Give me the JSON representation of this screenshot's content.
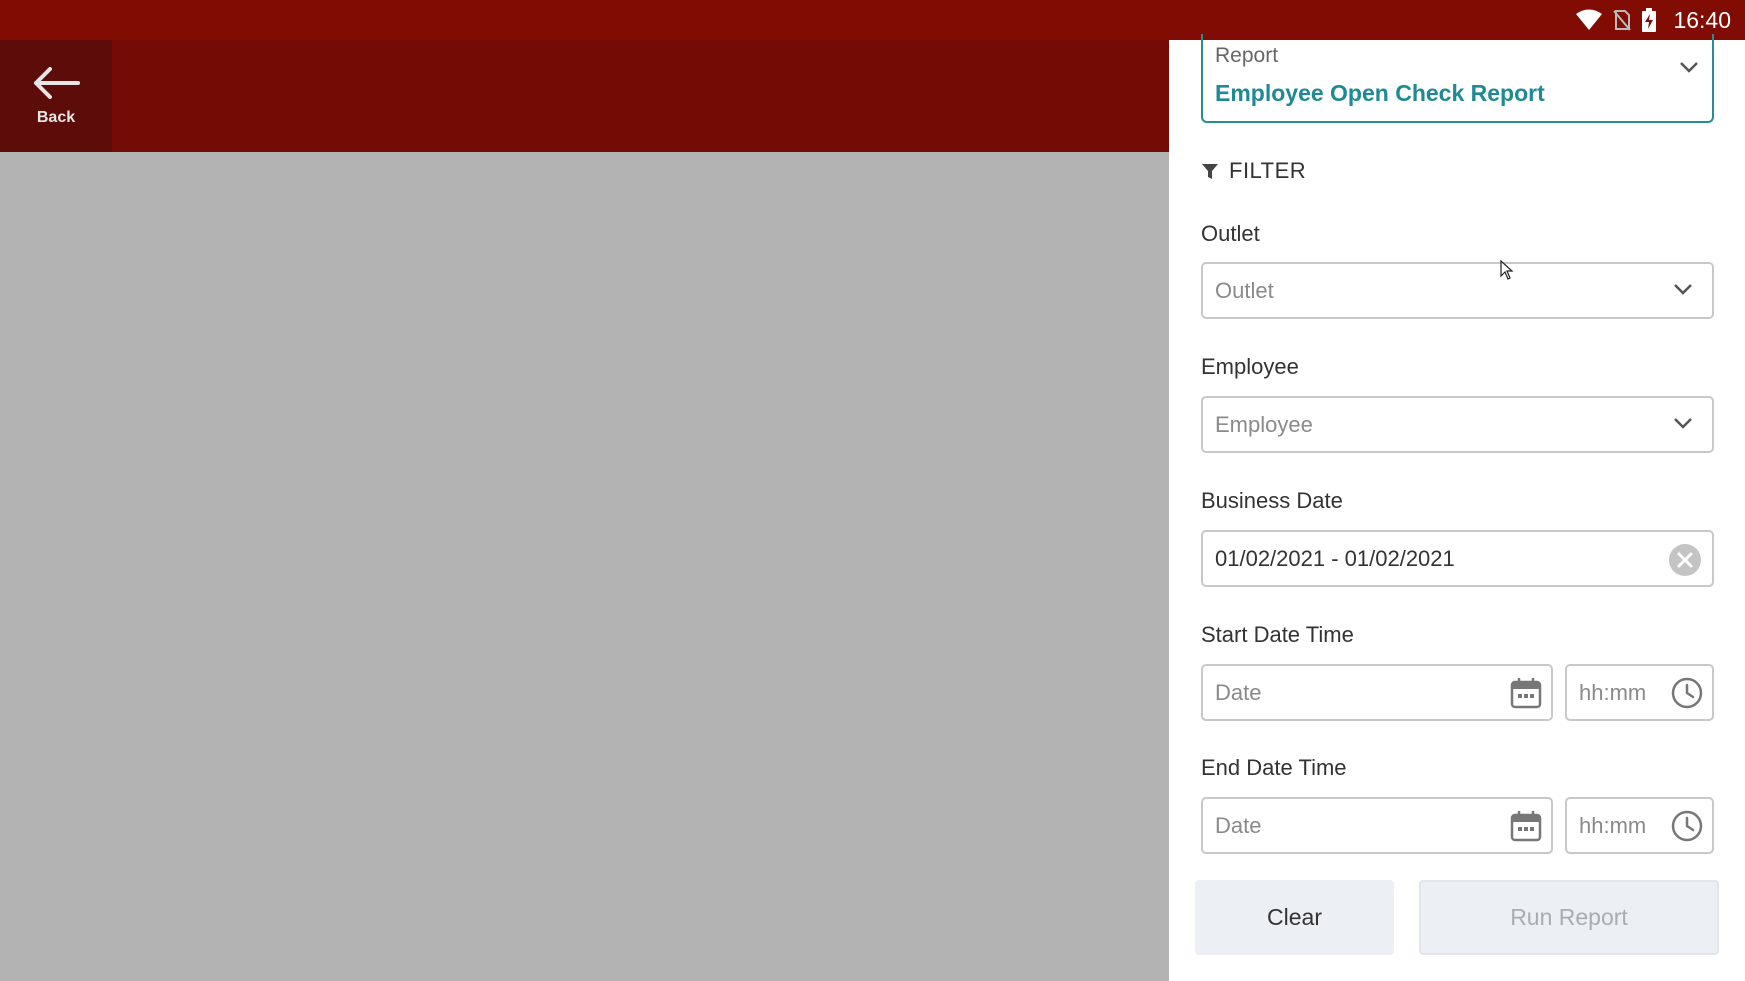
{
  "status_bar": {
    "time": "16:40",
    "icons": [
      "wifi-icon",
      "no-sim-icon",
      "battery-charging-icon"
    ]
  },
  "app_bar": {
    "back_label": "Back",
    "back_icon": "arrow-left-icon"
  },
  "panel": {
    "report": {
      "caption": "Report",
      "value": "Employee Open Check Report"
    },
    "filter_title": "FILTER",
    "outlet": {
      "label": "Outlet",
      "placeholder": "Outlet"
    },
    "employee": {
      "label": "Employee",
      "placeholder": "Employee"
    },
    "business_date": {
      "label": "Business Date",
      "value": "01/02/2021 - 01/02/2021"
    },
    "start_date_time": {
      "label": "Start Date Time",
      "date_placeholder": "Date",
      "time_placeholder": "hh:mm"
    },
    "end_date_time": {
      "label": "End Date Time",
      "date_placeholder": "Date",
      "time_placeholder": "hh:mm"
    },
    "clear_label": "Clear",
    "run_label": "Run Report"
  },
  "colors": {
    "status_bar": "#800c04",
    "app_bar": "#740b05",
    "back_button": "#5c0d09",
    "accent": "#1f8a95",
    "overlay": "#b3b3b3"
  }
}
